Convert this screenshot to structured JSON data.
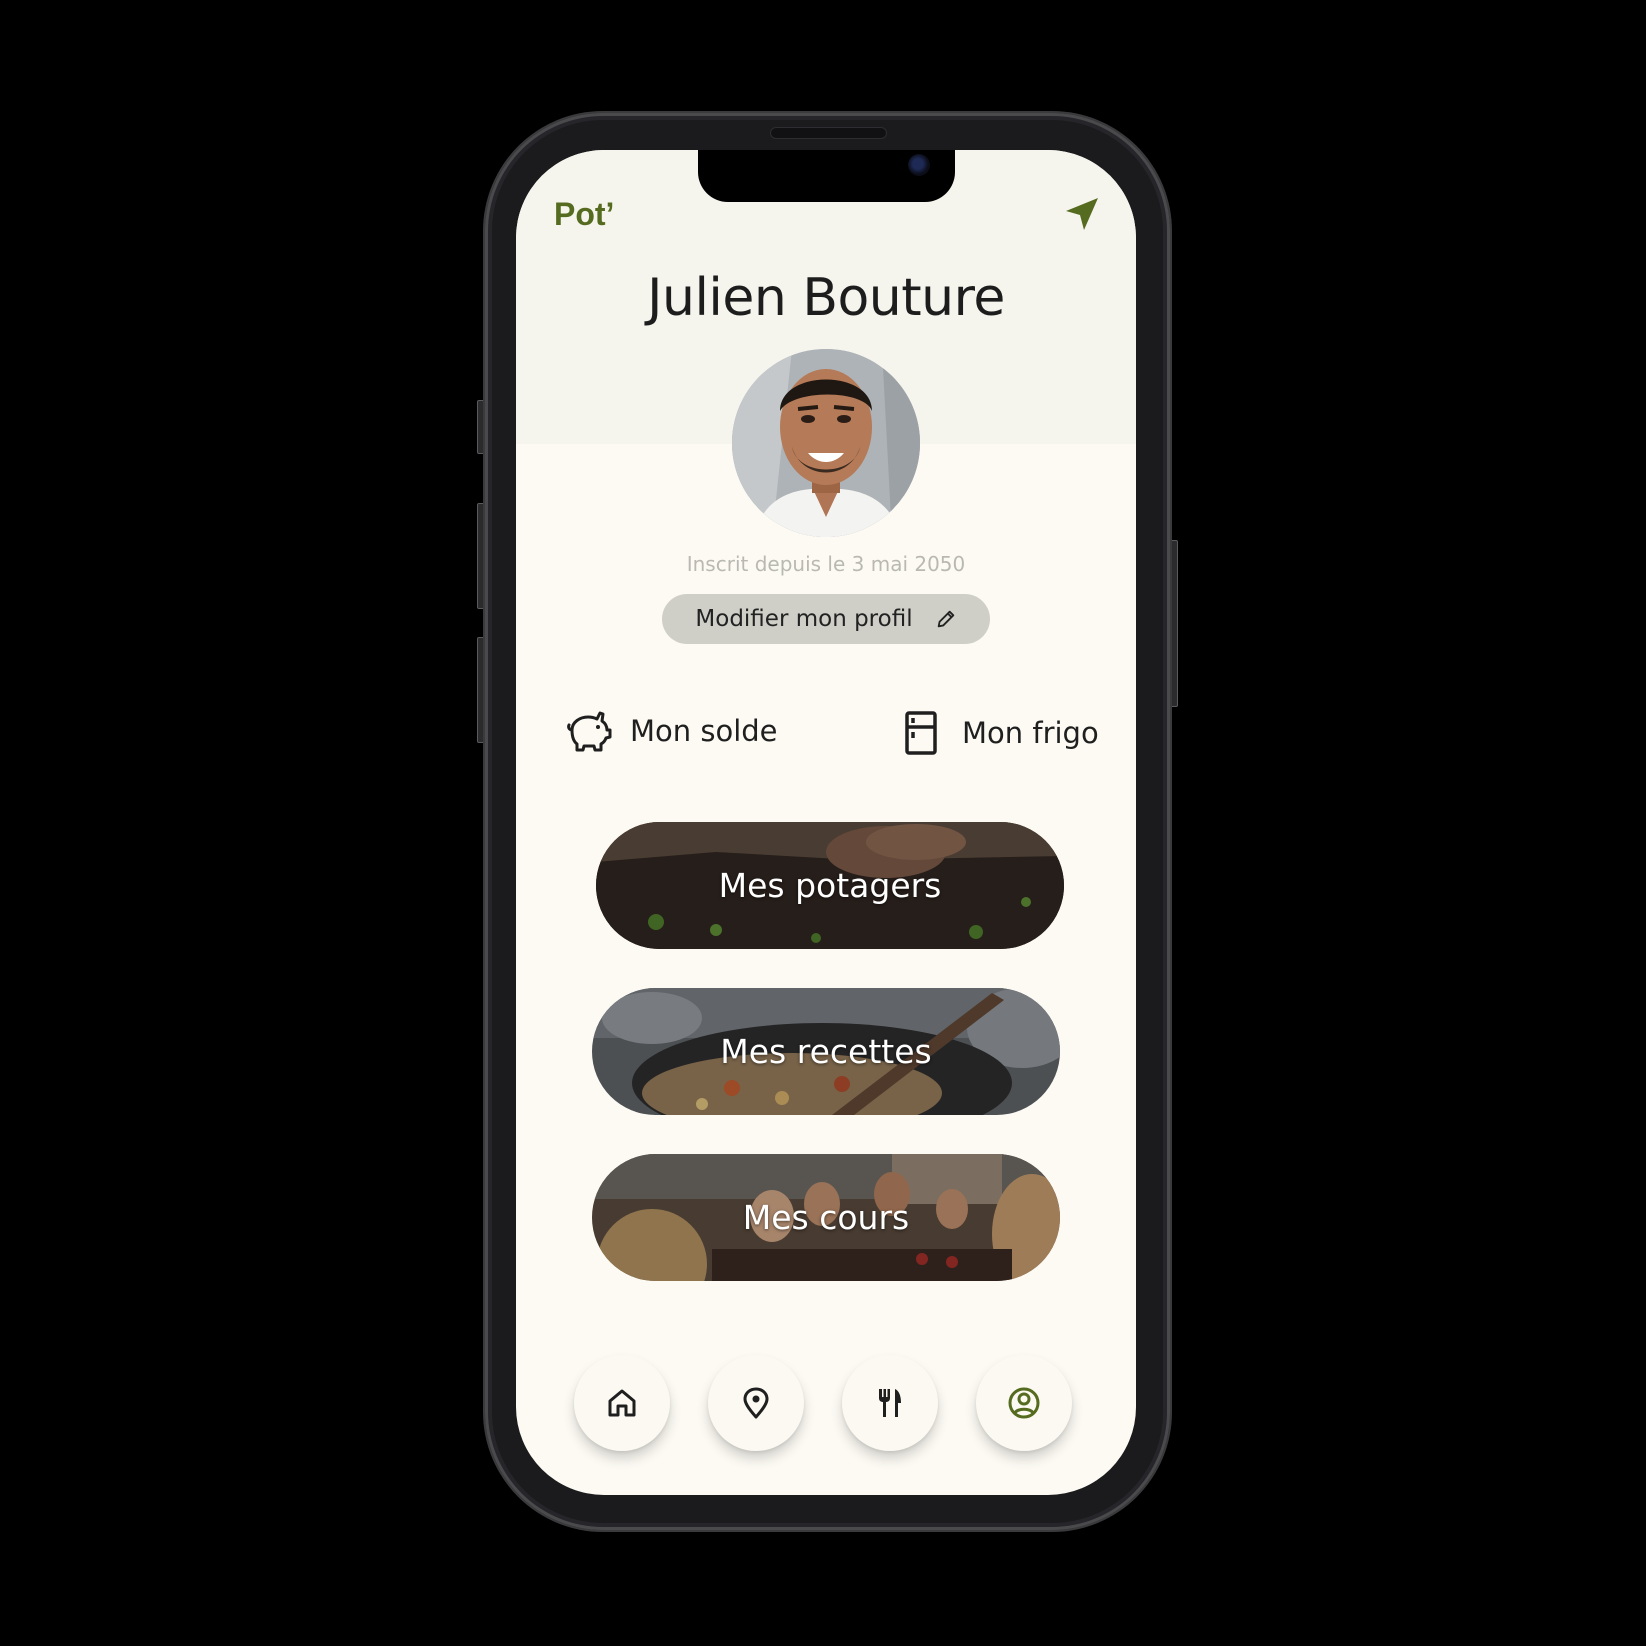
{
  "app": {
    "brand": "Pot’",
    "accent_color": "#556b1f"
  },
  "header": {
    "action_icon": "navigation-arrow-icon"
  },
  "profile": {
    "name": "Julien Bouture",
    "avatar": "avatar-photo",
    "member_since": "Inscrit depuis le 3 mai 2050",
    "edit_label": "Modifier mon profil",
    "edit_icon": "pencil-icon"
  },
  "quick_links": [
    {
      "label": "Mon solde",
      "icon": "piggy-bank-icon"
    },
    {
      "label": "Mon frigo",
      "icon": "fridge-icon"
    }
  ],
  "cards": [
    {
      "label": "Mes potagers",
      "image": "garden-soil-photo"
    },
    {
      "label": "Mes recettes",
      "image": "cooking-pan-photo"
    },
    {
      "label": "Mes cours",
      "image": "group-dinner-photo"
    }
  ],
  "tab_bar": [
    {
      "name": "home",
      "icon": "home-icon"
    },
    {
      "name": "map",
      "icon": "map-pin-icon"
    },
    {
      "name": "recipes",
      "icon": "fork-knife-icon"
    },
    {
      "name": "profile",
      "icon": "user-circle-icon",
      "active": true
    }
  ]
}
